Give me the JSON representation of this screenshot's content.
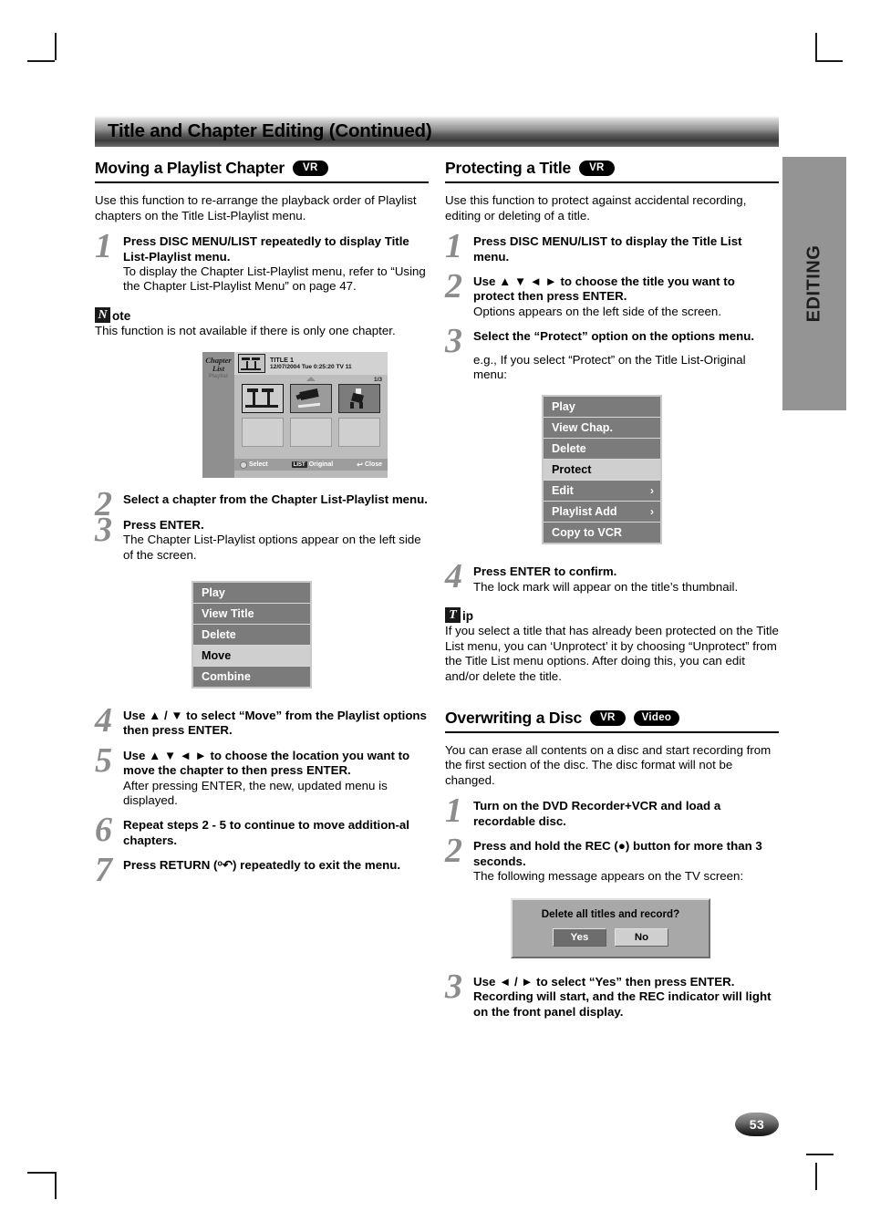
{
  "banner": {
    "title": "Title and Chapter Editing (Continued)"
  },
  "side_tab": {
    "label": "EDITING"
  },
  "page_number": "53",
  "badges": {
    "vr": "VR",
    "video": "Video"
  },
  "left_column": {
    "heading": "Moving a Playlist Chapter",
    "heading_badge": "VR",
    "intro": "Use this function to re-arrange the playback order of Playlist chapters on the Title List-Playlist menu.",
    "steps": [
      {
        "num": "1",
        "lead": "Press DISC MENU/LIST repeatedly to display Title List-Playlist menu.",
        "sub": "To display the Chapter List-Playlist menu, refer to “Using the Chapter List-Playlist Menu” on page 47."
      },
      {
        "num": "2",
        "lead": "Select a chapter from the Chapter List-Playlist menu.",
        "sub": ""
      },
      {
        "num": "3",
        "lead": "Press ENTER.",
        "sub": "The Chapter List-Playlist options appear on the left side of the screen."
      },
      {
        "num": "4",
        "lead": "Use ▲ / ▼ to select “Move” from the Playlist options then press ENTER.",
        "sub": ""
      },
      {
        "num": "5",
        "lead": "Use ▲ ▼ ◄ ► to choose the location you want to move the chapter to then press ENTER.",
        "sub": "After pressing ENTER, the new, updated menu is displayed."
      },
      {
        "num": "6",
        "lead": "Repeat steps 2 - 5 to continue to move addition-al chapters.",
        "sub": ""
      },
      {
        "num": "7",
        "lead": "Press RETURN (ᵒ↶) repeatedly to exit the menu.",
        "sub": ""
      }
    ],
    "note": {
      "glyph": "N",
      "title": "ote",
      "body": "This function is not available if there is only one chapter."
    },
    "options_menu": [
      {
        "label": "Play",
        "selected": false,
        "arrow": ""
      },
      {
        "label": "View Title",
        "selected": false,
        "arrow": ""
      },
      {
        "label": "Delete",
        "selected": false,
        "arrow": ""
      },
      {
        "label": "Move",
        "selected": true,
        "arrow": ""
      },
      {
        "label": "Combine",
        "selected": false,
        "arrow": ""
      }
    ]
  },
  "tv_mock": {
    "pane_title": "Chapter List",
    "pane_subtitle": "Playlist",
    "header_title": "TITLE 1",
    "header_meta": "12/07/2004  Tue 0:25:20   TV 11",
    "page_indicator": "1/3",
    "footer": {
      "select": "Select",
      "list_key": "LIST",
      "original": "Original",
      "close": "Close"
    }
  },
  "right_column": {
    "heading": "Protecting a Title",
    "heading_badge": "VR",
    "intro": "Use this function to protect against accidental recording, editing or deleting of a title.",
    "steps": [
      {
        "num": "1",
        "lead": "Press DISC MENU/LIST to display the Title List menu.",
        "sub": ""
      },
      {
        "num": "2",
        "lead": "Use ▲ ▼ ◄ ► to choose the title you want to protect then press ENTER.",
        "sub": "Options appears on the left side of the screen."
      },
      {
        "num": "3",
        "lead": "Select the “Protect” option on the options menu.",
        "sub": "e.g., If you select “Protect” on the Title List-Original menu:"
      },
      {
        "num": "4",
        "lead": "Press ENTER to confirm.",
        "sub": "The lock mark will appear on the title’s thumbnail."
      }
    ],
    "options_menu": [
      {
        "label": "Play",
        "selected": false,
        "arrow": ""
      },
      {
        "label": "View Chap.",
        "selected": false,
        "arrow": ""
      },
      {
        "label": "Delete",
        "selected": false,
        "arrow": ""
      },
      {
        "label": "Protect",
        "selected": true,
        "arrow": ""
      },
      {
        "label": "Edit",
        "selected": false,
        "arrow": "›"
      },
      {
        "label": "Playlist Add",
        "selected": false,
        "arrow": "›"
      },
      {
        "label": "Copy to VCR",
        "selected": false,
        "arrow": ""
      }
    ],
    "tip": {
      "glyph": "T",
      "title": "ip",
      "body": "If you select a title that has already been protected on the Title List menu, you can ‘Unprotect’ it by choosing “Unprotect” from the Title List menu options. After doing this, you can edit and/or delete the title."
    },
    "overwriting": {
      "heading": "Overwriting a Disc",
      "badge_vr": "VR",
      "badge_video": "Video",
      "intro": "You can erase all contents on a disc and start recording from the first section of the disc. The disc format will not be changed.",
      "steps": [
        {
          "num": "1",
          "lead": "Turn on the DVD Recorder+VCR and load a recordable disc.",
          "sub": ""
        },
        {
          "num": "2",
          "lead": "Press and hold the REC (●) button for more than 3 seconds.",
          "sub": "The following message appears on the TV screen:"
        },
        {
          "num": "3",
          "lead": "Use ◄ / ► to select “Yes” then press ENTER. Recording will start, and the REC indicator will light on the front panel display.",
          "sub": ""
        }
      ],
      "dialog": {
        "question": "Delete all titles and record?",
        "yes": "Yes",
        "no": "No"
      }
    }
  }
}
